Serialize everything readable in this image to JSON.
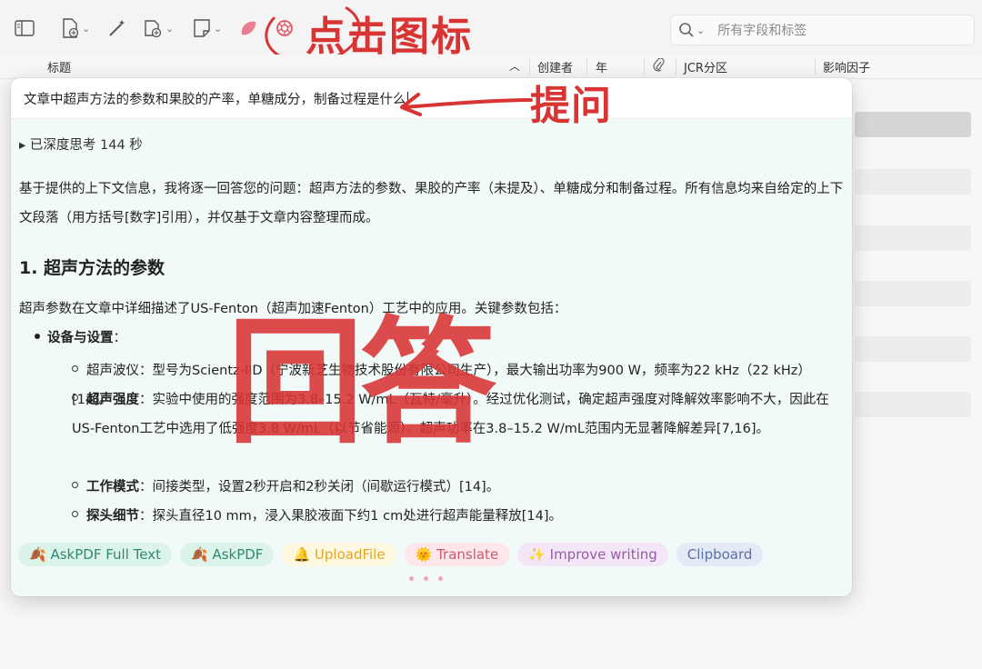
{
  "toolbar": {
    "icons": [
      "sidebar-toggle-icon",
      "new-item-icon",
      "magic-wand-icon",
      "add-attachment-icon",
      "new-note-icon",
      "petal-icon",
      "openai-icon"
    ],
    "search_placeholder": "所有字段和标签"
  },
  "annotations": {
    "click_icon": "点击图标",
    "ask": "提问",
    "answer": "回答"
  },
  "columns": {
    "title": "标题",
    "creator": "创建者",
    "year": "年",
    "jcr": "JCR分区",
    "impact": "影响因子"
  },
  "popup": {
    "question": "文章中超声方法的参数和果胶的产率，单糖成分，制备过程是什么",
    "thinking": "▸ 已深度思考 144 秒",
    "intro": "基于提供的上下文信息，我将逐一回答您的问题：超声方法的参数、果胶的产率（未提及）、单糖成分和制备过程。所有信息均来自给定的上下文段落（用方括号[数字]引用），并仅基于文章内容整理而成。",
    "section1_title": "1. 超声方法的参数",
    "section1_intro": "超声参数在文章中详细描述了US-Fenton（超声加速Fenton）工艺中的应用。关键参数包括：",
    "group1_label": "设备与设置",
    "group1_colon": "：",
    "items": [
      {
        "label": "",
        "text": "超声波仪：型号为Scientz-IID（宁波新芝生物技术股份有限公司生产），最大输出功率为900 W，频率为22 kHz（22 kHz）[14]。"
      },
      {
        "label": "超声强度",
        "text": "：实验中使用的强度范围为3.8–15.2 W/mL（瓦特/毫升）。经过优化测试，确定超声强度对降解效率影响不大，因此在US-Fenton工艺中选用了低强度3.8 W/mL（以节省能源）。超声功率在3.8–15.2 W/mL范围内无显著降解差异[7,16]。"
      },
      {
        "label": "工作模式",
        "text": "：间接类型，设置2秒开启和2秒关闭（间歇运行模式）[14]。"
      },
      {
        "label": "探头细节",
        "text": "：探头直径10 mm，浸入果胶液面下约1 cm处进行超声能量释放[14]。"
      }
    ],
    "chips": [
      "AskPDF Full Text",
      "AskPDF",
      "UploadFile",
      "Translate",
      "Improve writing",
      "Clipboard"
    ],
    "chip_icons": [
      "🍂",
      "🍂",
      "🔔",
      "🌞",
      "✨",
      ""
    ]
  }
}
